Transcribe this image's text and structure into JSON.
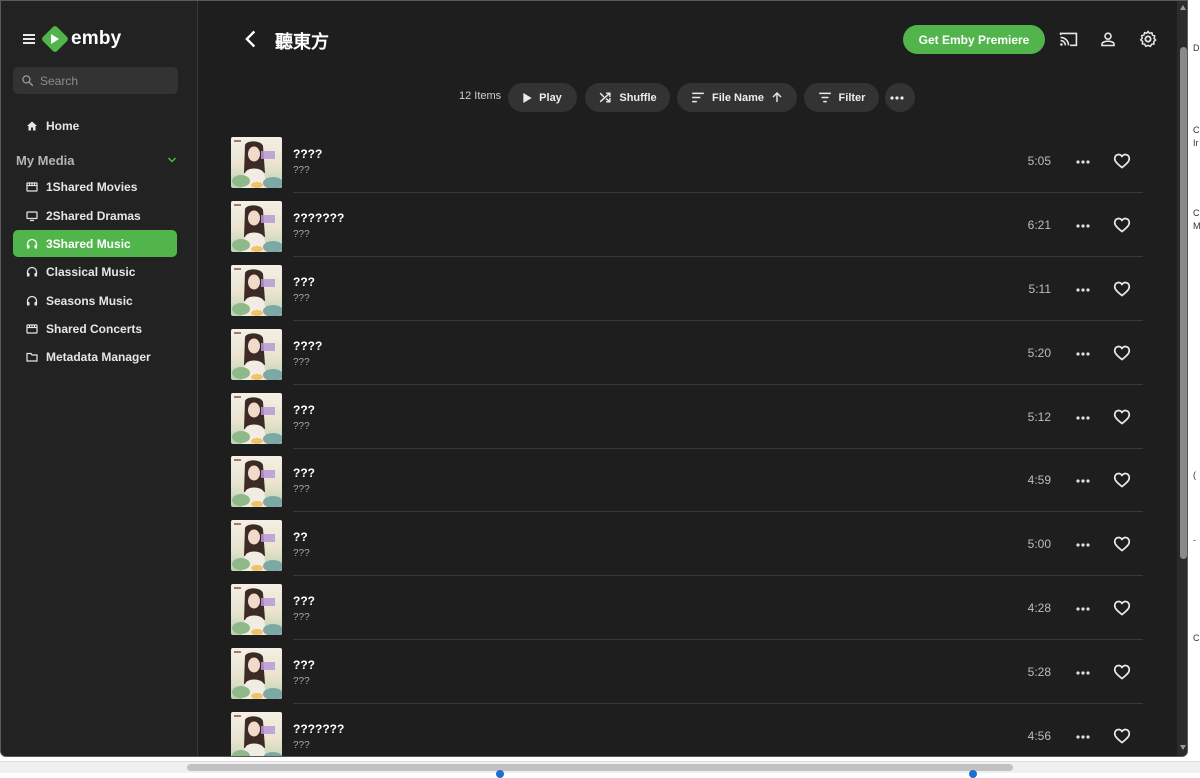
{
  "app": {
    "brand": "emby"
  },
  "search": {
    "placeholder": "Search"
  },
  "nav": {
    "home": "Home",
    "section": "My Media",
    "items": [
      {
        "label": "1Shared Movies",
        "icon": "movie-icon"
      },
      {
        "label": "2Shared Dramas",
        "icon": "tv-icon"
      },
      {
        "label": "3Shared Music",
        "icon": "headphones-icon",
        "active": true
      },
      {
        "label": "Classical Music",
        "icon": "headphones-icon"
      },
      {
        "label": "Seasons Music",
        "icon": "headphones-icon"
      },
      {
        "label": "Shared Concerts",
        "icon": "movie-icon"
      },
      {
        "label": "Metadata Manager",
        "icon": "folder-icon"
      }
    ]
  },
  "header": {
    "title": "聽東方",
    "premiere": "Get Emby Premiere"
  },
  "toolbar": {
    "count": "12 Items",
    "play": "Play",
    "shuffle": "Shuffle",
    "sort": "File Name",
    "filter": "Filter"
  },
  "tracks": [
    {
      "title": "????",
      "artist": "???",
      "duration": "5:05"
    },
    {
      "title": "???????",
      "artist": "???",
      "duration": "6:21"
    },
    {
      "title": "???",
      "artist": "???",
      "duration": "5:11"
    },
    {
      "title": "????",
      "artist": "???",
      "duration": "5:20"
    },
    {
      "title": "???",
      "artist": "???",
      "duration": "5:12"
    },
    {
      "title": "???",
      "artist": "???",
      "duration": "4:59"
    },
    {
      "title": "??",
      "artist": "???",
      "duration": "5:00"
    },
    {
      "title": "???",
      "artist": "???",
      "duration": "4:28"
    },
    {
      "title": "???",
      "artist": "???",
      "duration": "5:28"
    },
    {
      "title": "???????",
      "artist": "???",
      "duration": "4:56"
    }
  ],
  "edge_text": [
    "D",
    "C",
    "Ir",
    "C",
    "M",
    "(",
    "-",
    "C"
  ],
  "colors": {
    "accent": "#52b54b",
    "background": "#1e1e1e",
    "sidebar": "#222222"
  }
}
